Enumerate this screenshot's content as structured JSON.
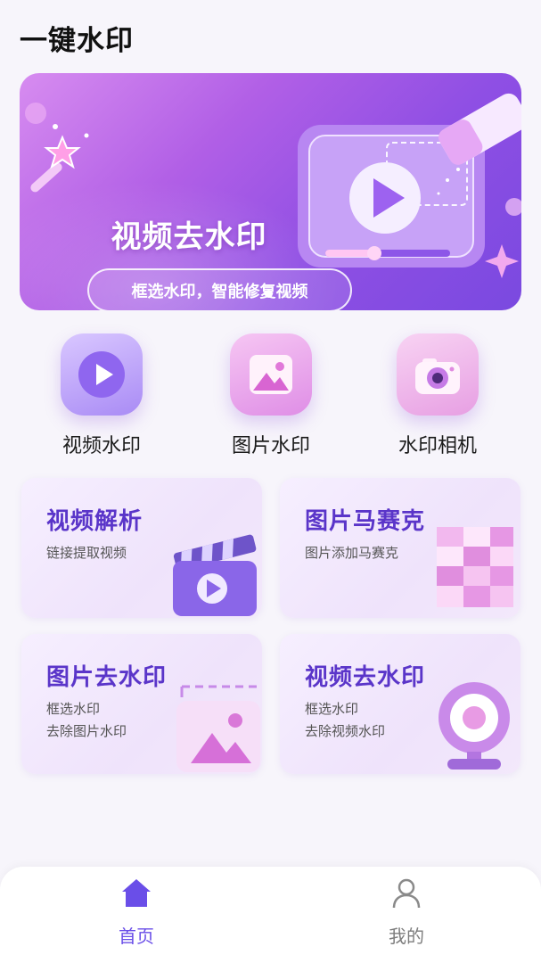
{
  "app": {
    "title": "一键水印"
  },
  "banner": {
    "title": "视频去水印",
    "subtitle": "框选水印，智能修复视频",
    "pages": 3,
    "active_page": 2
  },
  "quick_actions": [
    {
      "label": "视频水印",
      "icon": "play-icon"
    },
    {
      "label": "图片水印",
      "icon": "image-icon"
    },
    {
      "label": "水印相机",
      "icon": "camera-icon"
    }
  ],
  "cards": [
    {
      "title": "视频解析",
      "lines": [
        "链接提取视频"
      ],
      "icon": "clapperboard-icon"
    },
    {
      "title": "图片马赛克",
      "lines": [
        "图片添加马赛克"
      ],
      "icon": "mosaic-icon"
    },
    {
      "title": "图片去水印",
      "lines": [
        "框选水印",
        "去除图片水印"
      ],
      "icon": "image-frame-icon"
    },
    {
      "title": "视频去水印",
      "lines": [
        "框选水印",
        "去除视频水印"
      ],
      "icon": "webcam-icon"
    }
  ],
  "bottom_nav": [
    {
      "label": "首页",
      "icon": "home-icon",
      "active": true
    },
    {
      "label": "我的",
      "icon": "user-icon",
      "active": false
    }
  ],
  "colors": {
    "accent": "#6a4ee8",
    "card_title": "#5a35c9",
    "banner_start": "#d78cf0",
    "banner_end": "#7a49e0"
  }
}
